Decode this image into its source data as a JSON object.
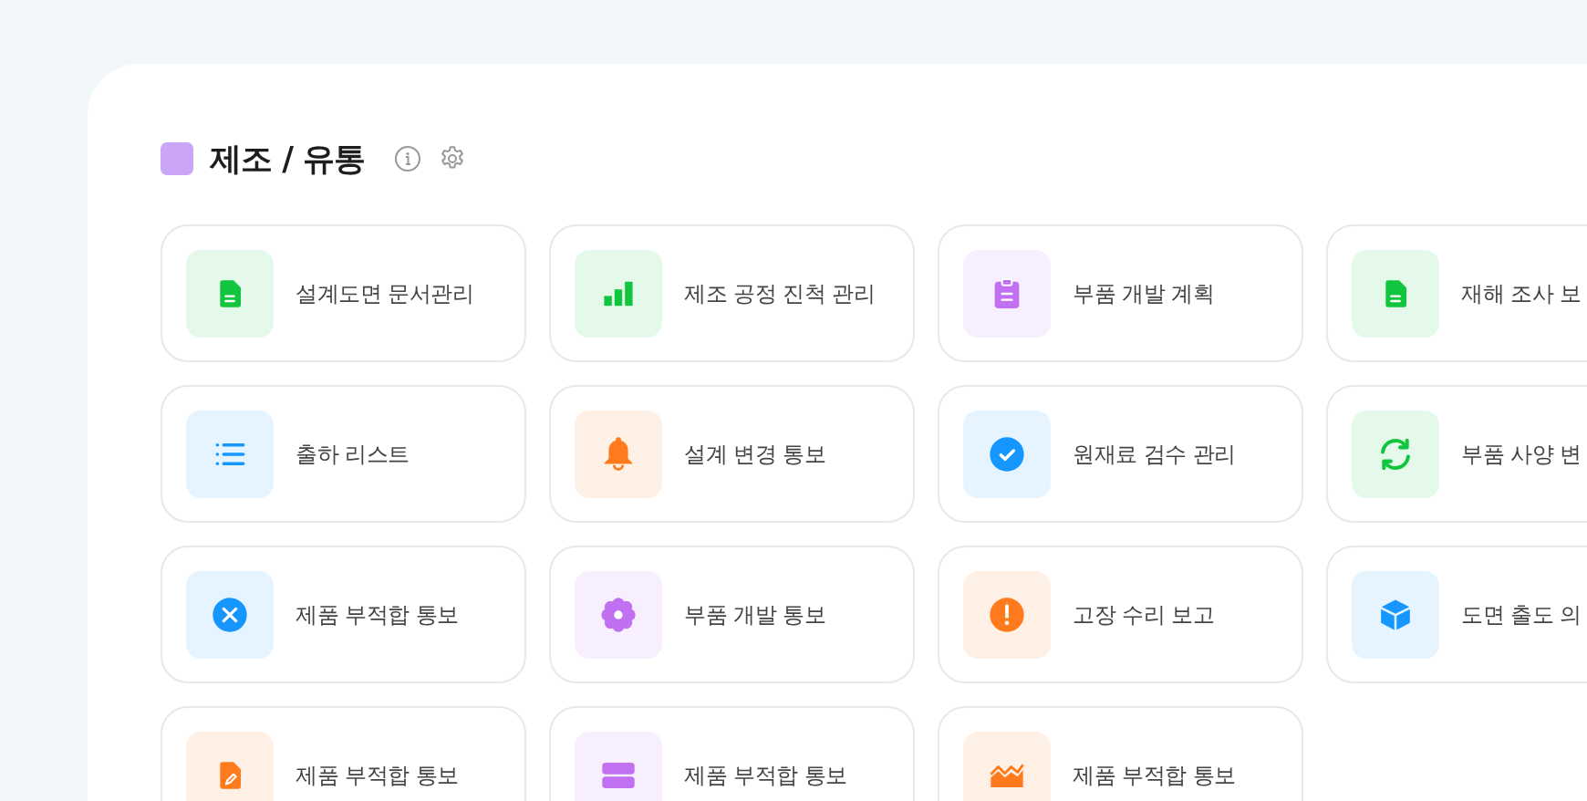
{
  "section": {
    "title": "제조 / 유통",
    "color": "#cba6f7"
  },
  "items": [
    {
      "label": "설계도면 문서관리",
      "kind": "file",
      "color": "#12c53f"
    },
    {
      "label": "제조 공정 진척 관리",
      "kind": "bars",
      "color": "#12c53f"
    },
    {
      "label": "부품 개발 계획",
      "kind": "clipboard",
      "color": "#c270f2"
    },
    {
      "label": "재해 조사 보",
      "kind": "file",
      "color": "#12c53f"
    },
    {
      "label": "출하 리스트",
      "kind": "list",
      "color": "#1597ff"
    },
    {
      "label": "설계 변경 통보",
      "kind": "bell",
      "color": "#ff7a1c"
    },
    {
      "label": "원재료 검수 관리",
      "kind": "check",
      "color": "#1597ff"
    },
    {
      "label": "부품 사양 변",
      "kind": "refresh",
      "color": "#12c53f"
    },
    {
      "label": "제품 부적합 통보",
      "kind": "x",
      "color": "#1597ff"
    },
    {
      "label": "부품 개발 통보",
      "kind": "flower",
      "color": "#c270f2"
    },
    {
      "label": "고장 수리 보고",
      "kind": "alert",
      "color": "#ff7a1c"
    },
    {
      "label": "도면 출도 의",
      "kind": "cube",
      "color": "#1597ff"
    },
    {
      "label": "제품 부적합 통보",
      "kind": "fileedit",
      "color": "#ff7a1c"
    },
    {
      "label": "제품 부적합 통보",
      "kind": "server",
      "color": "#c270f2"
    },
    {
      "label": "제품 부적합 통보",
      "kind": "area",
      "color": "#ff7a1c"
    }
  ]
}
